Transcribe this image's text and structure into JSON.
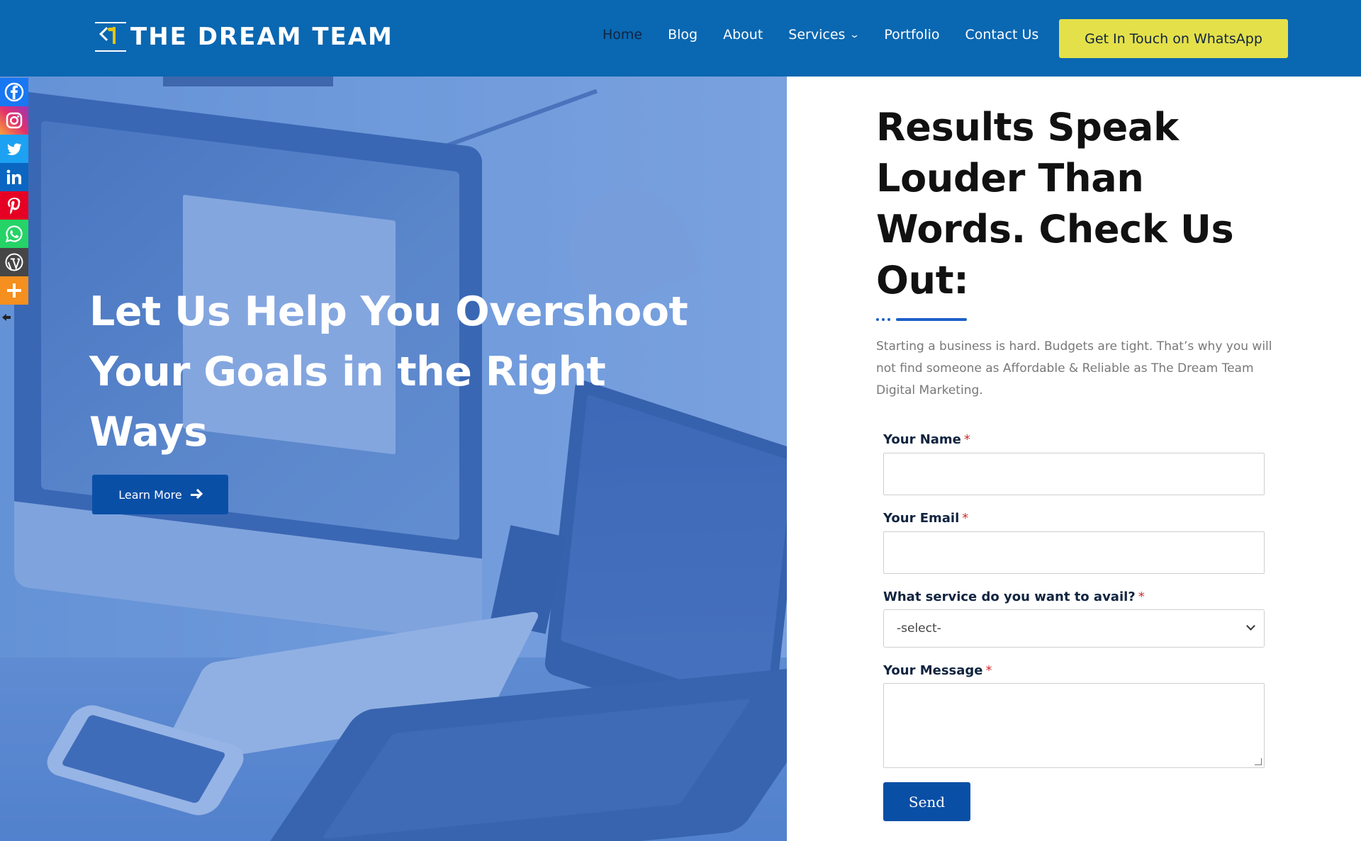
{
  "brand": {
    "name": "THE DREAM TEAM"
  },
  "nav": {
    "items": [
      {
        "label": "Home",
        "active": true
      },
      {
        "label": "Blog"
      },
      {
        "label": "About"
      },
      {
        "label": "Services",
        "has_dropdown": true
      },
      {
        "label": "Portfolio"
      },
      {
        "label": "Contact Us"
      }
    ],
    "cta_label": "Get In Touch on WhatsApp"
  },
  "hero": {
    "title": "Let Us Help You Overshoot Your Goals in the Right Ways",
    "button_label": "Learn More",
    "button_icon": "arrow-right-icon"
  },
  "social_bar": {
    "items": [
      {
        "name": "facebook",
        "color": "#1877f2"
      },
      {
        "name": "instagram",
        "color": "#e1306c"
      },
      {
        "name": "twitter",
        "color": "#1da1f2"
      },
      {
        "name": "linkedin",
        "color": "#0a66c2"
      },
      {
        "name": "pinterest",
        "color": "#e60023"
      },
      {
        "name": "whatsapp",
        "color": "#25d366"
      },
      {
        "name": "wordpress",
        "color": "#464646"
      },
      {
        "name": "more",
        "color": "#f58f1f"
      }
    ]
  },
  "results": {
    "title": "Results Speak Louder Than Words. Check Us Out:",
    "intro": "Starting a business is hard. Budgets are tight. That’s why you will not find someone as Affordable & Reliable as The Dream Team Digital Marketing."
  },
  "form": {
    "name_label": "Your Name",
    "email_label": "Your Email",
    "service_label": "What service do you want to avail?",
    "service_selected": "-select-",
    "message_label": "Your Message",
    "required_mark": "*",
    "submit_label": "Send"
  },
  "colors": {
    "header_bg": "#0a67b1",
    "cta_bg": "#e4e04a",
    "button_bg": "#0a4fa6",
    "accent": "#1d60c9",
    "required": "#d22d2d"
  }
}
